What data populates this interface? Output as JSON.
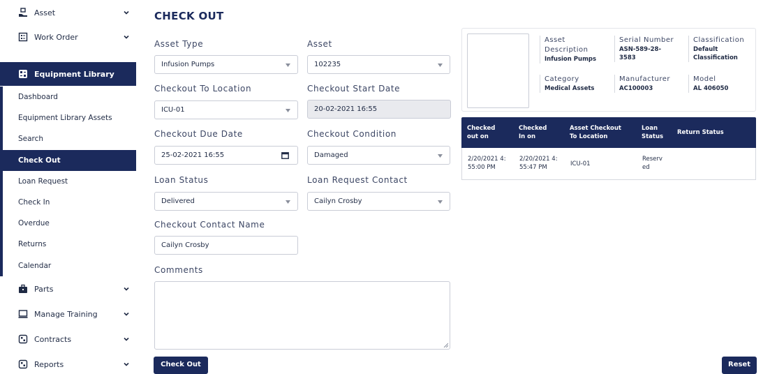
{
  "sidebar": {
    "top_items": [
      {
        "label": "Asset",
        "icon": "hand-box-icon"
      },
      {
        "label": "Work Order",
        "icon": "calendar-list-icon"
      }
    ],
    "active_parent": {
      "label": "Equipment Library",
      "icon": "library-icon"
    },
    "sub_items": [
      {
        "label": "Dashboard"
      },
      {
        "label": "Equipment Library Assets"
      },
      {
        "label": "Search"
      },
      {
        "label": "Check Out",
        "active": true
      },
      {
        "label": "Loan Request"
      },
      {
        "label": "Check In"
      },
      {
        "label": "Overdue"
      },
      {
        "label": "Returns"
      },
      {
        "label": "Calendar"
      }
    ],
    "bottom_items": [
      {
        "label": "Parts",
        "icon": "briefcase-icon"
      },
      {
        "label": "Manage Training",
        "icon": "monitor-icon"
      },
      {
        "label": "Contracts",
        "icon": "document-icon"
      },
      {
        "label": "Reports",
        "icon": "report-icon"
      }
    ]
  },
  "page": {
    "title": "CHECK OUT"
  },
  "form": {
    "asset_type": {
      "label": "Asset Type",
      "value": "Infusion Pumps"
    },
    "asset": {
      "label": "Asset",
      "value": "102235"
    },
    "checkout_to_location": {
      "label": "Checkout To Location",
      "value": "ICU-01"
    },
    "checkout_start_date": {
      "label": "Checkout Start Date",
      "value": "20-02-2021 16:55"
    },
    "checkout_due_date": {
      "label": "Checkout Due Date",
      "value": "25-02-2021 16:55"
    },
    "checkout_condition": {
      "label": "Checkout Condition",
      "value": "Damaged"
    },
    "loan_status": {
      "label": "Loan Status",
      "value": "Delivered"
    },
    "loan_request_contact": {
      "label": "Loan Request Contact",
      "value": "Cailyn Crosby"
    },
    "checkout_contact_name": {
      "label": "Checkout Contact Name",
      "value": "Cailyn Crosby"
    },
    "comments": {
      "label": "Comments",
      "value": ""
    },
    "checkout_button": "Check Out",
    "reset_button": "Reset"
  },
  "asset_info": {
    "asset_description": {
      "label_line1": "Asset",
      "label_line2": "Description",
      "value": "Infusion Pumps"
    },
    "serial_number": {
      "label": "Serial Number",
      "value_line1": "ASN-589-28-",
      "value_line2": "3583"
    },
    "classification": {
      "label": "Classification",
      "value_line1": "Default",
      "value_line2": "Classification"
    },
    "category": {
      "label": "Category",
      "value": "Medical Assets"
    },
    "manufacturer": {
      "label": "Manufacturer",
      "value": "AC100003"
    },
    "model": {
      "label": "Model",
      "value": "AL 406050"
    }
  },
  "history_table": {
    "headers": [
      {
        "line1": "Checked",
        "line2": "out on"
      },
      {
        "line1": "Checked",
        "line2": "In on"
      },
      {
        "line1": "Asset Checkout",
        "line2": "To Location"
      },
      {
        "line1": "Loan",
        "line2": "Status"
      },
      {
        "line1": "Return Status",
        "line2": ""
      }
    ],
    "rows": [
      {
        "checked_out_line1": "2/20/2021 4:",
        "checked_out_line2": "55:00 PM",
        "checked_in_line1": "2/20/2021 4:",
        "checked_in_line2": "55:47 PM",
        "location": "ICU-01",
        "loan_status_line1": "Reserv",
        "loan_status_line2": "ed",
        "return_status": ""
      }
    ]
  },
  "colors": {
    "primary": "#1b2a5c",
    "border": "#c9ccd6",
    "disabled_bg": "#e9eaee"
  }
}
